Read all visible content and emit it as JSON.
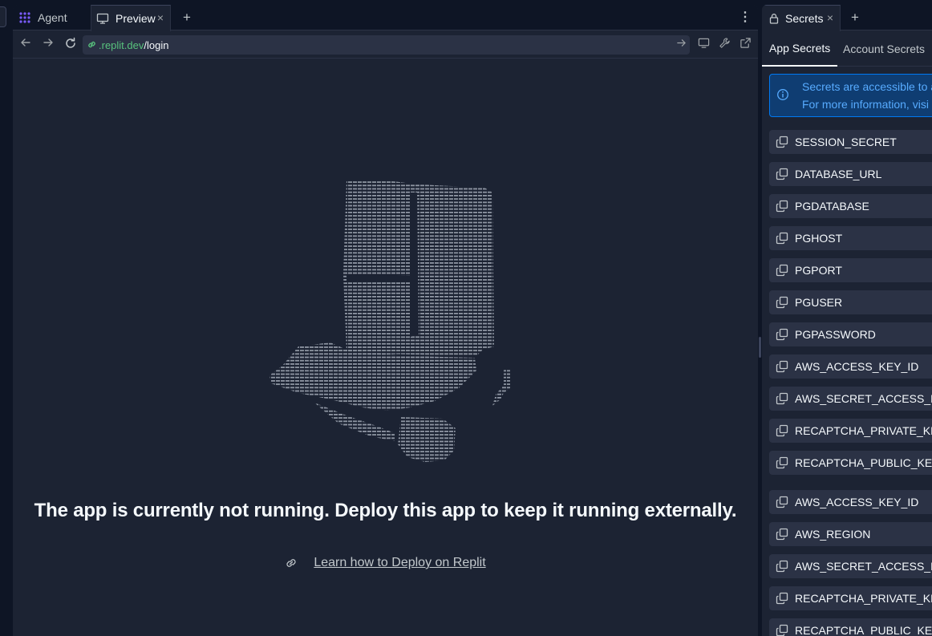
{
  "tabs": {
    "agent_label": "Agent",
    "preview_label": "Preview",
    "close_glyph": "×",
    "new_tab_glyph": "+",
    "more_glyph": "⋮"
  },
  "address": {
    "domain": ".replit.dev",
    "path": "/login"
  },
  "preview": {
    "message": "The app is currently not running. Deploy this app to keep it running externally.",
    "learn_link": "Learn how to Deploy on Replit"
  },
  "secrets_pane": {
    "tab_label": "Secrets",
    "close_glyph": "×",
    "new_tab_glyph": "+",
    "subtabs": [
      "App Secrets",
      "Account Secrets"
    ],
    "active_subtab": "App Secrets",
    "info_line1": "Secrets are accessible to a",
    "info_line2": "For more information, visi",
    "items": [
      "SESSION_SECRET",
      "DATABASE_URL",
      "PGDATABASE",
      "PGHOST",
      "PGPORT",
      "PGUSER",
      "PGPASSWORD",
      "AWS_ACCESS_KEY_ID",
      "AWS_SECRET_ACCESS_KEY",
      "RECAPTCHA_PRIVATE_KEY",
      "RECAPTCHA_PUBLIC_KEY",
      "AWS_ACCESS_KEY_ID",
      "AWS_REGION",
      "AWS_SECRET_ACCESS_KEY",
      "RECAPTCHA_PRIVATE_KEY",
      "RECAPTCHA_PUBLIC_KEY"
    ]
  },
  "colors": {
    "background": "#0e1525",
    "surface": "#1c2333",
    "control": "#2b3245",
    "accent_blue": "#0079f2",
    "info_text": "#57abff",
    "url_green": "#58c27d"
  }
}
